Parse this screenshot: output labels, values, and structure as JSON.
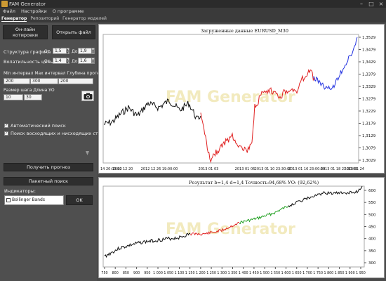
{
  "window": {
    "title": "FAM Generator",
    "min": "–",
    "max": "□",
    "close": "×"
  },
  "menu": [
    "Файл",
    "Настройки",
    "О программе"
  ],
  "tabs": [
    "Генератор",
    "Репозиторий",
    "Генератор моделей"
  ],
  "left": {
    "online_btn": "Он-лайн котировки",
    "open_btn": "Открыть файл",
    "struct_label": "Структура графика",
    "struct_from": "От",
    "struct_from_val": "1,5",
    "struct_to": "До",
    "struct_to_val": "1,9",
    "vol_label": "Волатильность цены",
    "vol_from": "От",
    "vol_from_val": "1,4",
    "vol_to": "До",
    "vol_to_val": "1,6",
    "hdr_row": "Min интервал Max интервал Глубина прогноза",
    "min_int": "200",
    "max_int": "300",
    "depth": "200",
    "step_label": "Размер шага Длина УО",
    "step": "10",
    "length": "30",
    "auto_search": "Автоматический поиск",
    "trend_search": "Поиск восходящих и нисходящих структур",
    "forecast_btn": "Получить прогноз",
    "batch_btn": "Пакетный поиск",
    "indicators_label": "Индикаторы:",
    "indicator_item": "Bollinger Bands",
    "ok_btn": "OK"
  },
  "chart1": {
    "title": "Загруженные данные EURUSD_M30",
    "yticks": [
      "1,3529",
      "1,3479",
      "1,3429",
      "1,3379",
      "1,3329",
      "1,3279",
      "1,3229",
      "1,3179",
      "1,3129",
      "1,3079",
      "1,3029"
    ],
    "xticks": [
      "14 20:00:00",
      "2012 12 20",
      "2012 12 26 19:00:00",
      "2013 01 03",
      "2013 01 06",
      "2013 01 10 23:30:00",
      "2013 01 16 23:00:00",
      "2013 01 18 21:30:00",
      "2013 01 24"
    ],
    "watermark_a": "FAM ",
    "watermark_b": "Generator",
    "colors": {
      "history": "#111111",
      "model": "#e02020",
      "forecast": "#2030e0"
    }
  },
  "chart2": {
    "title": "Результат b=1,4 d=1,4  Точность:94,68%  УО: (92,62%)",
    "yticks": [
      "600",
      "550",
      "500",
      "450",
      "400",
      "350",
      "300"
    ],
    "xticks": [
      "750",
      "800",
      "850",
      "900",
      "950",
      "1 000",
      "1 050",
      "1 100",
      "1 150",
      "1 200",
      "1 250",
      "1 300",
      "1 350",
      "1 400",
      "1 450",
      "1 500",
      "1 550",
      "1 600",
      "1 650",
      "1 700",
      "1 750",
      "1 800",
      "1 850",
      "1 900",
      "1 950"
    ],
    "watermark_a": "FAM ",
    "watermark_b": "Generator",
    "colors": {
      "a": "#111111",
      "b": "#e02020",
      "c": "#20a020"
    }
  }
}
